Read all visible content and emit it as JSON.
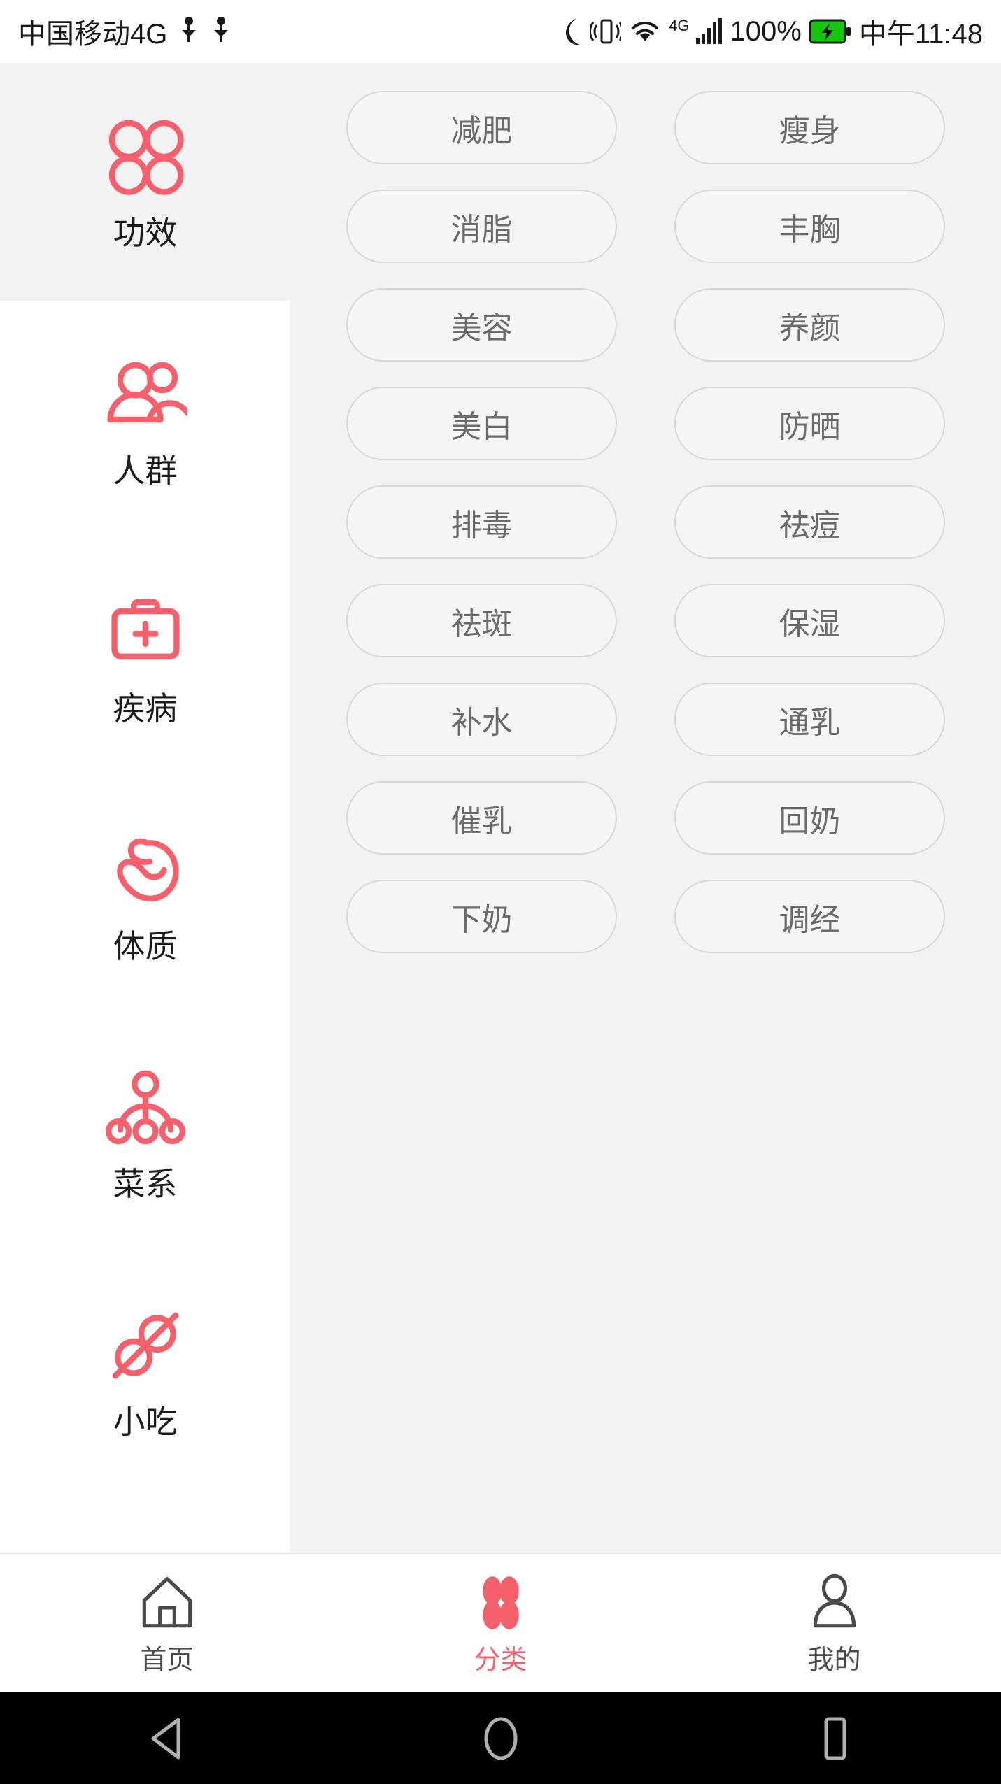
{
  "status_bar": {
    "carrier": "中国移动4G",
    "usb_icon_1": "usb-icon",
    "usb_icon_2": "usb-icon",
    "moon_icon": "moon-icon",
    "vibrate_icon": "vibrate-icon",
    "wifi_icon": "wifi-icon",
    "network_type": "4G",
    "signal_icon": "signal-bars-icon",
    "battery_percent": "100%",
    "battery_icon": "battery-charging-icon",
    "time": "中午11:48"
  },
  "sidebar": {
    "items": [
      {
        "label": "功效",
        "icon": "four-circles-icon",
        "active": true
      },
      {
        "label": "人群",
        "icon": "people-group-icon",
        "active": false
      },
      {
        "label": "疾病",
        "icon": "medical-kit-icon",
        "active": false
      },
      {
        "label": "体质",
        "icon": "flexed-bicep-icon",
        "active": false
      },
      {
        "label": "菜系",
        "icon": "hierarchy-tree-icon",
        "active": false
      },
      {
        "label": "小吃",
        "icon": "food-skewer-icon",
        "active": false
      }
    ]
  },
  "tags": [
    "减肥",
    "瘦身",
    "消脂",
    "丰胸",
    "美容",
    "养颜",
    "美白",
    "防晒",
    "排毒",
    "祛痘",
    "祛斑",
    "保湿",
    "补水",
    "通乳",
    "催乳",
    "回奶",
    "下奶",
    "调经"
  ],
  "tab_bar": {
    "items": [
      {
        "label": "首页",
        "icon": "home-icon",
        "active": false
      },
      {
        "label": "分类",
        "icon": "four-petals-icon",
        "active": true
      },
      {
        "label": "我的",
        "icon": "person-icon",
        "active": false
      }
    ]
  },
  "android_nav": {
    "back": "back-triangle-icon",
    "home": "home-circle-icon",
    "recents": "recents-square-icon"
  },
  "colors": {
    "accent": "#f4606c",
    "page_bg": "#f2f2f2",
    "sidebar_bg": "#ffffff",
    "tag_border": "#d8d8d8",
    "tag_text": "#6b6b6b"
  }
}
